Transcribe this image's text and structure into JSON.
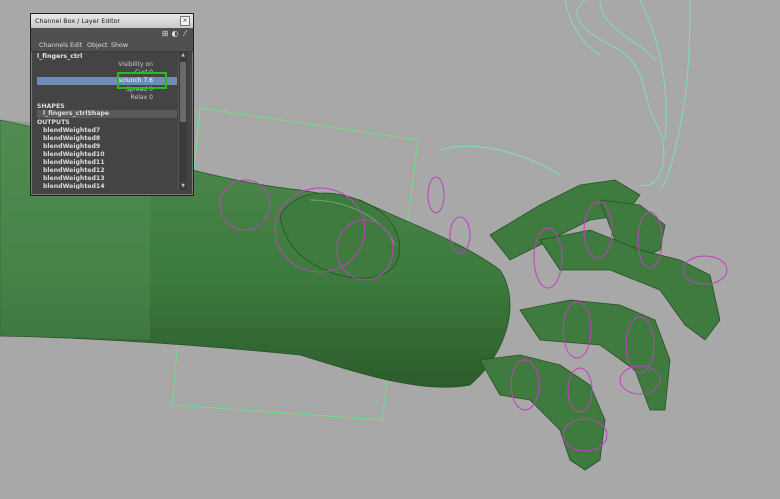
{
  "window": {
    "title": "Channel Box / Layer Editor",
    "close_glyph": "×"
  },
  "menu": [
    "Channels",
    "Edit",
    "Object",
    "Show"
  ],
  "node": "l_fingers_ctrl",
  "attributes": [
    {
      "name": "Visibility",
      "value": "on"
    },
    {
      "name": "Curl",
      "value": "0"
    },
    {
      "name": "Scrunch",
      "value": "7.6"
    },
    {
      "name": "Spread",
      "value": "0"
    },
    {
      "name": "Relax",
      "value": "0"
    }
  ],
  "selected_attribute": "Scrunch",
  "shapes_header": "SHAPES",
  "shape": "l_fingers_ctrlShape",
  "outputs_header": "OUTPUTS",
  "outputs": [
    "blendWeighted7",
    "blendWeighted8",
    "blendWeighted9",
    "blendWeighted10",
    "blendWeighted11",
    "blendWeighted12",
    "blendWeighted13",
    "blendWeighted14"
  ],
  "icons": [
    "channel-box-toggle-icon",
    "layer-editor-icon",
    "tool-settings-icon"
  ],
  "colors": {
    "viewport": "#a8a8a8",
    "mesh": "#3f7a3f",
    "mesh_dark": "#2d5a2d",
    "control_curve": "#c13fc1",
    "selection_box": "#6de08a",
    "highlight": "#1fc11f"
  }
}
